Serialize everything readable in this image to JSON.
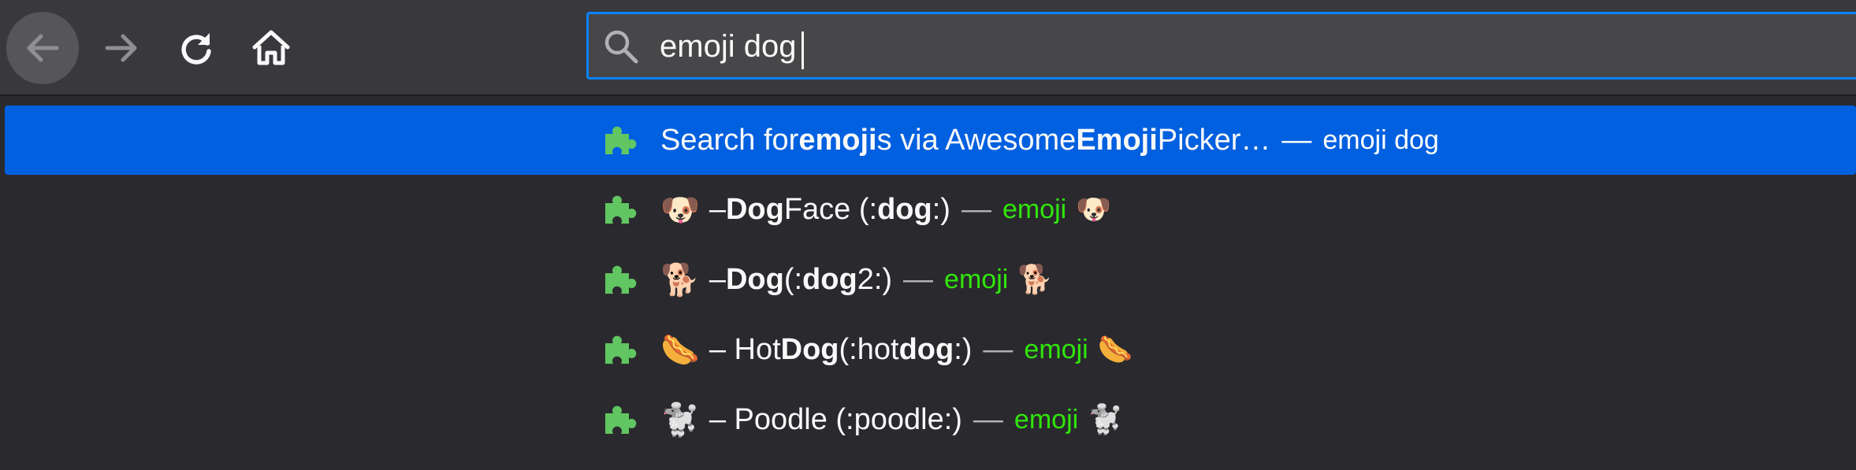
{
  "urlbar": {
    "value": "emoji dog"
  },
  "icons": {
    "back": "back-arrow-icon",
    "forward": "forward-arrow-icon",
    "reload": "reload-icon",
    "home": "home-icon",
    "search": "search-icon",
    "extension": "puzzle-piece-icon"
  },
  "colors": {
    "toolbar": "#38383d",
    "popup": "#2a2a2e",
    "selected": "#0060df",
    "accent_border": "#0a84ff",
    "action_text": "#30e60b",
    "puzzle": "#61c661"
  },
  "results": [
    {
      "prefix": "Search for ",
      "bold1": "emoji",
      "mid": "s via Awesome ",
      "bold2": "Emoji",
      "suffix": " Picker…",
      "separator": "—",
      "action": "emoji dog"
    },
    {
      "emoji": "🐶",
      "prefix": " – ",
      "bold1": "Dog",
      "mid": " Face (:",
      "bold2": "dog",
      "suffix": ":)",
      "separator": "—",
      "action": "emoji",
      "action_emoji": "🐶"
    },
    {
      "emoji": "🐕",
      "prefix": " – ",
      "bold1": "Dog",
      "mid": " (:",
      "bold2": "dog",
      "suffix": "2:)",
      "separator": "—",
      "action": "emoji",
      "action_emoji": "🐕"
    },
    {
      "emoji": "🌭",
      "prefix": " – Hot ",
      "bold1": "Dog",
      "mid": " (:hot",
      "bold2": "dog",
      "suffix": ":)",
      "separator": "—",
      "action": "emoji",
      "action_emoji": "🌭"
    },
    {
      "emoji": "🐩",
      "prefix": " – Poodle (:poodle:)",
      "bold1": "",
      "mid": "",
      "bold2": "",
      "suffix": "",
      "separator": "—",
      "action": "emoji",
      "action_emoji": "🐩"
    }
  ]
}
